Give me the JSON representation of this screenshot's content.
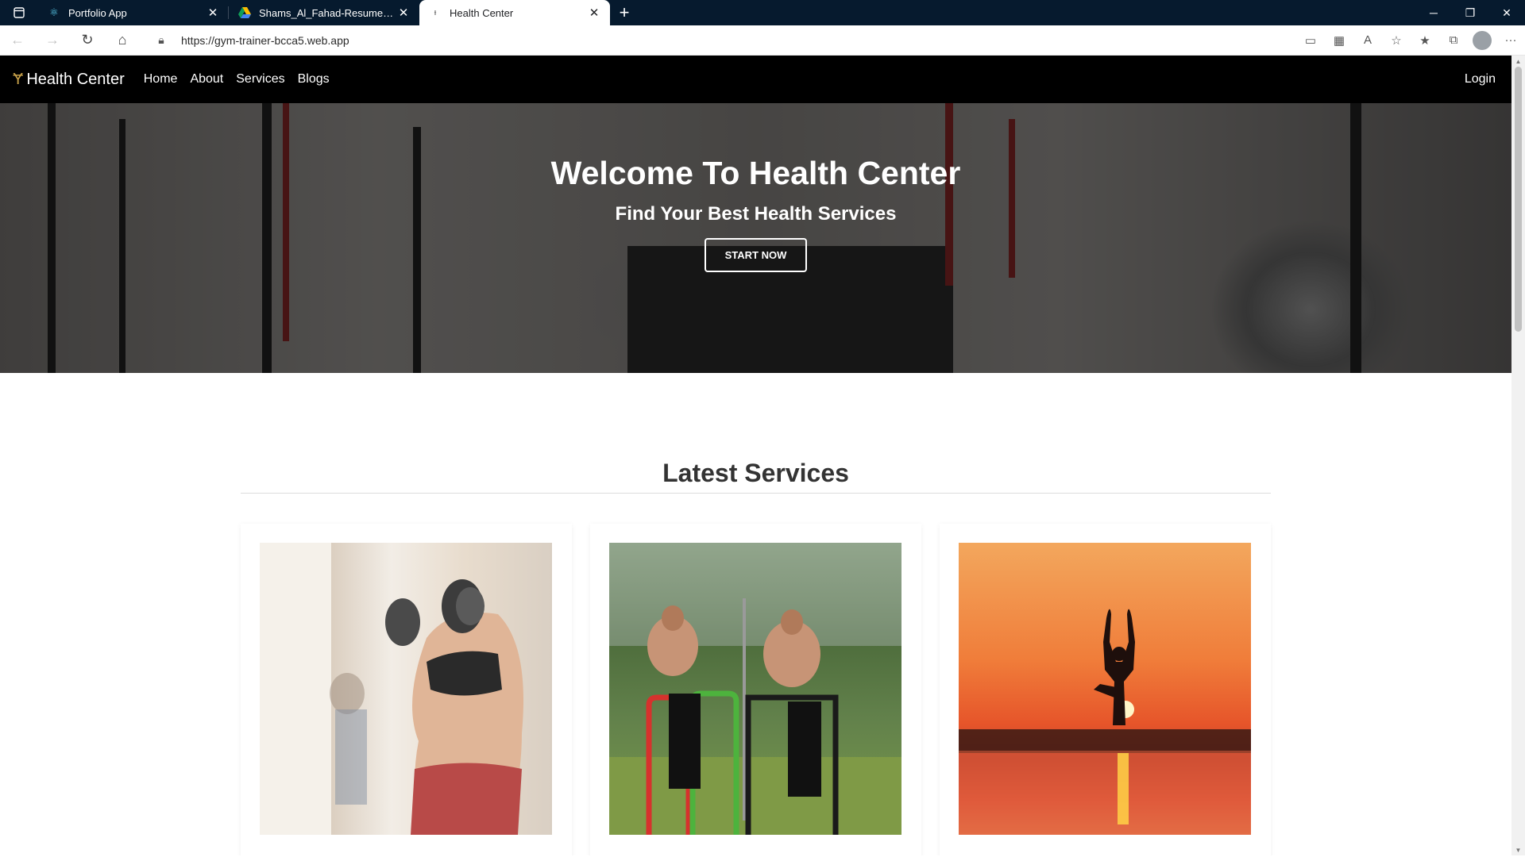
{
  "browser": {
    "tabs": [
      {
        "title": "Portfolio App",
        "active": false,
        "favicon": "react-icon"
      },
      {
        "title": "Shams_Al_Fahad-Resume-converted",
        "active": false,
        "favicon": "drive-icon"
      },
      {
        "title": "Health Center",
        "active": true,
        "favicon": "dumbbell-icon"
      }
    ],
    "url": "https://gym-trainer-bcca5.web.app"
  },
  "site": {
    "brand": "Health Center",
    "nav": [
      "Home",
      "About",
      "Services",
      "Blogs"
    ],
    "login": "Login"
  },
  "hero": {
    "title": "Welcome To Health Center",
    "subtitle": "Find Your Best Health Services",
    "cta": "START NOW"
  },
  "services": {
    "heading": "Latest Services",
    "cards": [
      {
        "image": "woman-lifting-dumbbell"
      },
      {
        "image": "men-doing-dips-in-park"
      },
      {
        "image": "yoga-silhouette-sunset"
      }
    ]
  },
  "colors": {
    "navbar": "#000000",
    "tabbar": "#061a2e",
    "heading": "#333333"
  }
}
